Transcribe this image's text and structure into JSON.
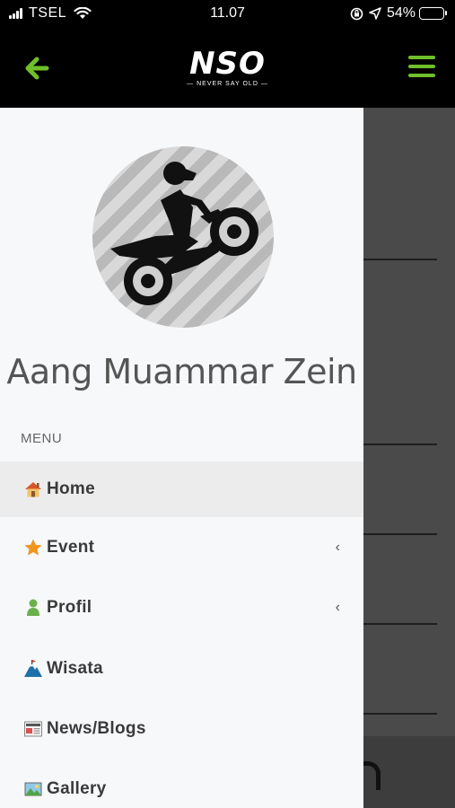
{
  "status_bar": {
    "carrier": "TSEL",
    "time": "11.07",
    "battery": "54%",
    "battery_level": 0.54,
    "icons": [
      "signal-icon",
      "wifi-icon",
      "screen-lock-icon",
      "location-icon",
      "battery-icon"
    ]
  },
  "header": {
    "logo": "NSO",
    "logo_tagline": "— NEVER SAY OLD —",
    "back_icon": "arrow-left-icon",
    "menu_icon": "hamburger-menu-icon",
    "accent_color": "#6fbf2a"
  },
  "drawer": {
    "user_name": "Aang Muammar Zein",
    "avatar": "motocross-rider-avatar",
    "menu_label": "MENU",
    "items": [
      {
        "label": "Home",
        "icon": "house-icon",
        "active": true,
        "has_submenu": false
      },
      {
        "label": "Event",
        "icon": "star-icon",
        "active": false,
        "has_submenu": true,
        "chevron": "‹"
      },
      {
        "label": "Profil",
        "icon": "person-icon",
        "active": false,
        "has_submenu": true,
        "chevron": "‹"
      },
      {
        "label": "Wisata",
        "icon": "mountain-icon",
        "active": false,
        "has_submenu": false
      },
      {
        "label": "News/Blogs",
        "icon": "newspaper-icon",
        "active": false,
        "has_submenu": false
      },
      {
        "label": "Gallery",
        "icon": "picture-icon",
        "active": false,
        "has_submenu": false
      }
    ]
  }
}
